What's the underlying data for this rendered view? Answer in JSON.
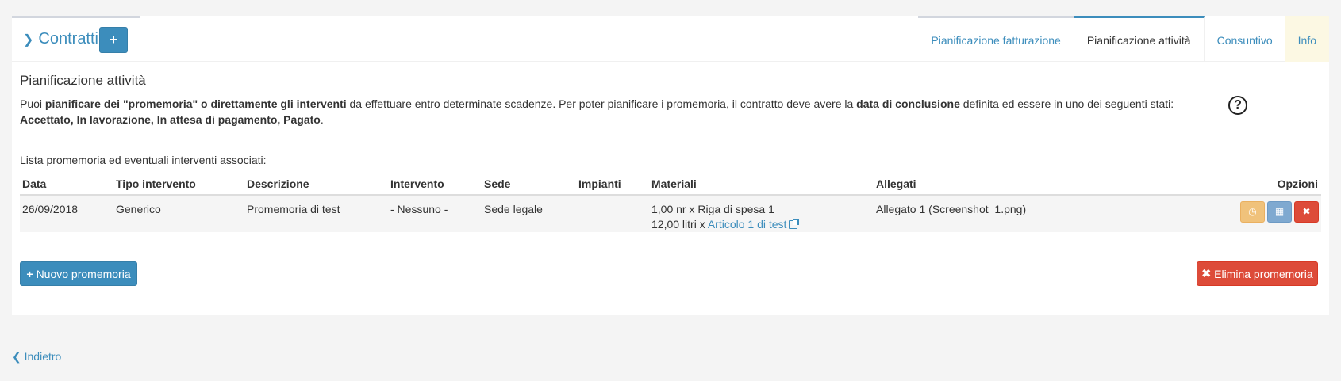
{
  "header": {
    "title": "Contratti",
    "add_button": "+"
  },
  "tabs": [
    {
      "label": "Pianificazione fatturazione"
    },
    {
      "label": "Pianificazione attività"
    },
    {
      "label": "Consuntivo"
    },
    {
      "label": "Info"
    }
  ],
  "section": {
    "title": "Pianificazione attività",
    "desc_1": "Puoi ",
    "desc_2": "pianificare dei \"promemoria\" o direttamente gli interventi",
    "desc_3": " da effettuare entro determinate scadenze. Per poter pianificare i promemoria, il contratto deve avere la ",
    "desc_4": "data di conclusione",
    "desc_5": " definita ed essere in uno dei seguenti stati: ",
    "desc_6": "Accettato, In lavorazione, In attesa di pagamento, Pagato",
    "desc_7": ".",
    "help_icon": "?",
    "list_label": "Lista promemoria ed eventuali interventi associati:"
  },
  "table": {
    "headers": {
      "data": "Data",
      "tipo": "Tipo intervento",
      "descrizione": "Descrizione",
      "intervento": "Intervento",
      "sede": "Sede",
      "impianti": "Impianti",
      "materiali": "Materiali",
      "allegati": "Allegati",
      "opzioni": "Opzioni"
    },
    "rows": [
      {
        "data": "26/09/2018",
        "tipo": "Generico",
        "descrizione": "Promemoria di test",
        "intervento": "- Nessuno -",
        "sede": "Sede legale",
        "impianti": "",
        "materiale_1": "1,00 nr x Riga di spesa 1",
        "materiale_2_prefix": "12,00 litri x ",
        "materiale_2_link": "Articolo 1 di test",
        "allegati": "Allegato 1 (Screenshot_1.png)"
      }
    ]
  },
  "buttons": {
    "nuovo": "Nuovo promemoria",
    "elimina": "Elimina promemoria"
  },
  "footer": {
    "back": "Indietro"
  },
  "colors": {
    "primary": "#3c8dbc",
    "danger": "#dd4b39",
    "warning": "#f0c27b",
    "info": "#7fa9d0"
  }
}
